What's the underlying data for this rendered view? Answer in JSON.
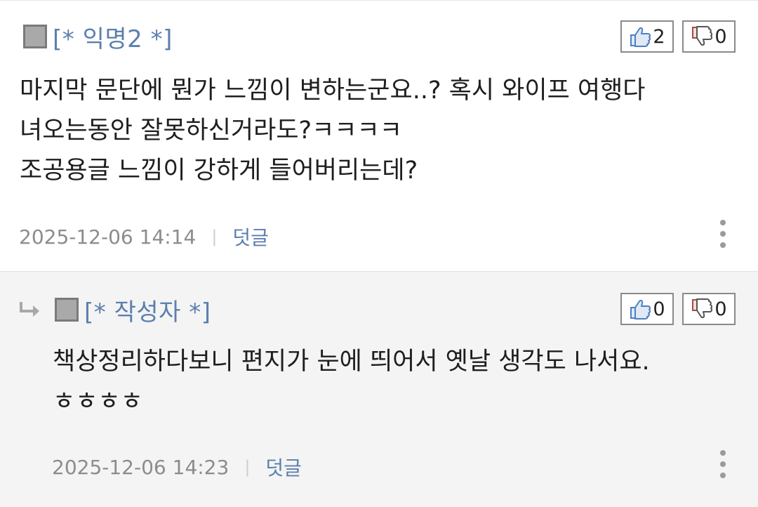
{
  "comments": [
    {
      "author": "[* 익명2 *]",
      "likes": "2",
      "dislikes": "0",
      "body": [
        "마지막 문단에 뭔가 느낌이 변하는군요..? 혹시 와이프 여행다",
        "녀오는동안 잘못하신거라도?ㅋㅋㅋㅋ",
        "조공용글 느낌이 강하게 들어버리는데?"
      ],
      "timestamp": "2025-12-06 14:14",
      "separator": "|",
      "reply_label": "덧글"
    },
    {
      "author": "[* 작성자 *]",
      "likes": "0",
      "dislikes": "0",
      "body": [
        "책상정리하다보니 편지가 눈에 띄어서 옛날 생각도 나서요.",
        "ㅎㅎㅎㅎ"
      ],
      "timestamp": "2025-12-06 14:23",
      "separator": "|",
      "reply_label": "덧글"
    }
  ],
  "icons": {
    "avatar": "avatar-square-icon",
    "like": "thumbs-up-icon",
    "dislike": "thumbs-down-icon",
    "reply_indicator": "reply-arrow-icon",
    "more": "more-vertical-icon"
  },
  "colors": {
    "author": "#5c7fae",
    "reply_link": "#5c7fae",
    "timestamp": "#8c8c8c",
    "reply_background": "#f4f4f4",
    "thumbs_up": "#5b86c4",
    "thumbs_down": "#b24a45"
  }
}
